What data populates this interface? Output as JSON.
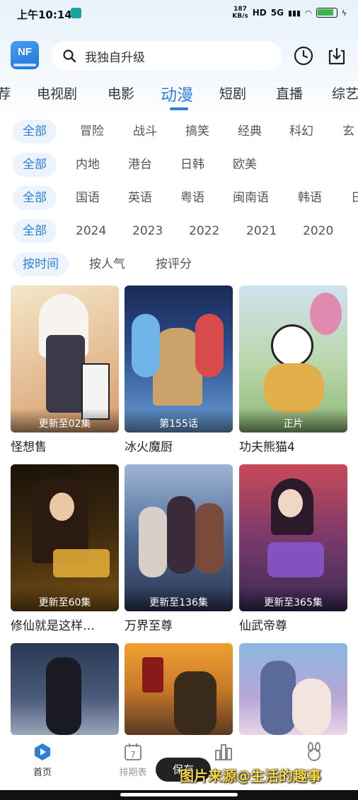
{
  "status_bar": {
    "time": "上午10:14",
    "net_speed_value": "187",
    "net_speed_unit": "KB/s",
    "hd_label": "HD",
    "signal_label": "5G"
  },
  "header": {
    "logo_text": "NF",
    "search_placeholder": "我独自升级"
  },
  "category_tabs": [
    {
      "label": "荐",
      "active": false
    },
    {
      "label": "电视剧",
      "active": false
    },
    {
      "label": "电影",
      "active": false
    },
    {
      "label": "动漫",
      "active": true
    },
    {
      "label": "短剧",
      "active": false
    },
    {
      "label": "直播",
      "active": false
    },
    {
      "label": "综艺",
      "active": false
    }
  ],
  "filters": {
    "genre": [
      "全部",
      "冒险",
      "战斗",
      "搞笑",
      "经典",
      "科幻",
      "玄"
    ],
    "region": [
      "全部",
      "内地",
      "港台",
      "日韩",
      "欧美"
    ],
    "language": [
      "全部",
      "国语",
      "英语",
      "粤语",
      "闽南语",
      "韩语",
      "日"
    ],
    "year": [
      "全部",
      "2024",
      "2023",
      "2022",
      "2021",
      "2020"
    ],
    "sort": [
      "按时间",
      "按人气",
      "按评分"
    ]
  },
  "cards": [
    {
      "title": "怪想售",
      "badge": "更新至02集"
    },
    {
      "title": "冰火魔厨",
      "badge": "第155话"
    },
    {
      "title": "功夫熊猫4",
      "badge": "正片"
    },
    {
      "title": "修仙就是这样…",
      "badge": "更新至60集"
    },
    {
      "title": "万界至尊",
      "badge": "更新至136集"
    },
    {
      "title": "仙武帝尊",
      "badge": "更新至365集"
    },
    {
      "title": "",
      "badge": ""
    },
    {
      "title": "",
      "badge": ""
    },
    {
      "title": "",
      "badge": ""
    }
  ],
  "bottom_nav": {
    "home": "首页",
    "schedule": "排期表",
    "schedule_day": "7",
    "save_button": "保存"
  },
  "watermark": "图片来源@生活的趣事",
  "colors": {
    "accent": "#2b7fd6",
    "chip_bg": "#edf4fd"
  }
}
